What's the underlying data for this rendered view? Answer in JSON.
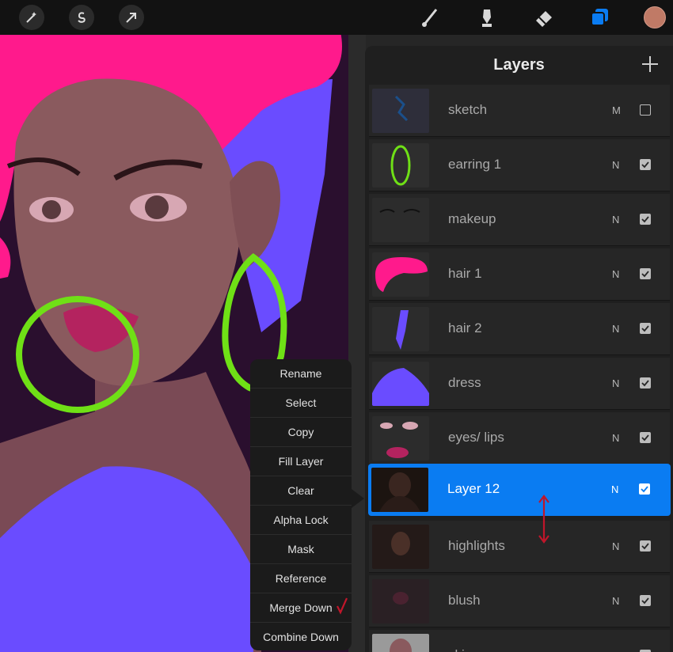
{
  "toolbar": {
    "left_icons": [
      "magic-wand-icon",
      "selection-icon",
      "transform-arrow-icon"
    ],
    "right_icons": [
      "brush-icon",
      "smudge-icon",
      "eraser-icon",
      "layers-icon"
    ],
    "active_tool": "layers",
    "current_color": "#c07a66"
  },
  "layers_panel": {
    "title": "Layers",
    "add_icon": "plus-icon",
    "items": [
      {
        "name": "sketch",
        "mode": "M",
        "visible": false,
        "selected": false
      },
      {
        "name": "earring 1",
        "mode": "N",
        "visible": true,
        "selected": false
      },
      {
        "name": "makeup",
        "mode": "N",
        "visible": true,
        "selected": false
      },
      {
        "name": "hair 1",
        "mode": "N",
        "visible": true,
        "selected": false
      },
      {
        "name": "hair 2",
        "mode": "N",
        "visible": true,
        "selected": false
      },
      {
        "name": "dress",
        "mode": "N",
        "visible": true,
        "selected": false
      },
      {
        "name": "eyes/ lips",
        "mode": "N",
        "visible": true,
        "selected": false
      },
      {
        "name": "Layer 12",
        "mode": "N",
        "visible": true,
        "selected": true
      },
      {
        "name": "highlights",
        "mode": "N",
        "visible": true,
        "selected": false
      },
      {
        "name": "blush",
        "mode": "N",
        "visible": true,
        "selected": false
      },
      {
        "name": "skin",
        "mode": "N",
        "visible": true,
        "selected": false
      }
    ]
  },
  "context_menu": {
    "items": [
      "Rename",
      "Select",
      "Copy",
      "Fill Layer",
      "Clear",
      "Alpha Lock",
      "Mask",
      "Reference",
      "Merge Down",
      "Combine Down"
    ],
    "annotated_item": "Merge Down"
  },
  "colors": {
    "accent": "#0a7cf2",
    "hair_pink": "#ff1a8c",
    "hair_blue": "#6a4cff",
    "earring_green": "#6fe016",
    "dress_purple": "#6a4cff",
    "annotation_red": "#c0162a"
  }
}
